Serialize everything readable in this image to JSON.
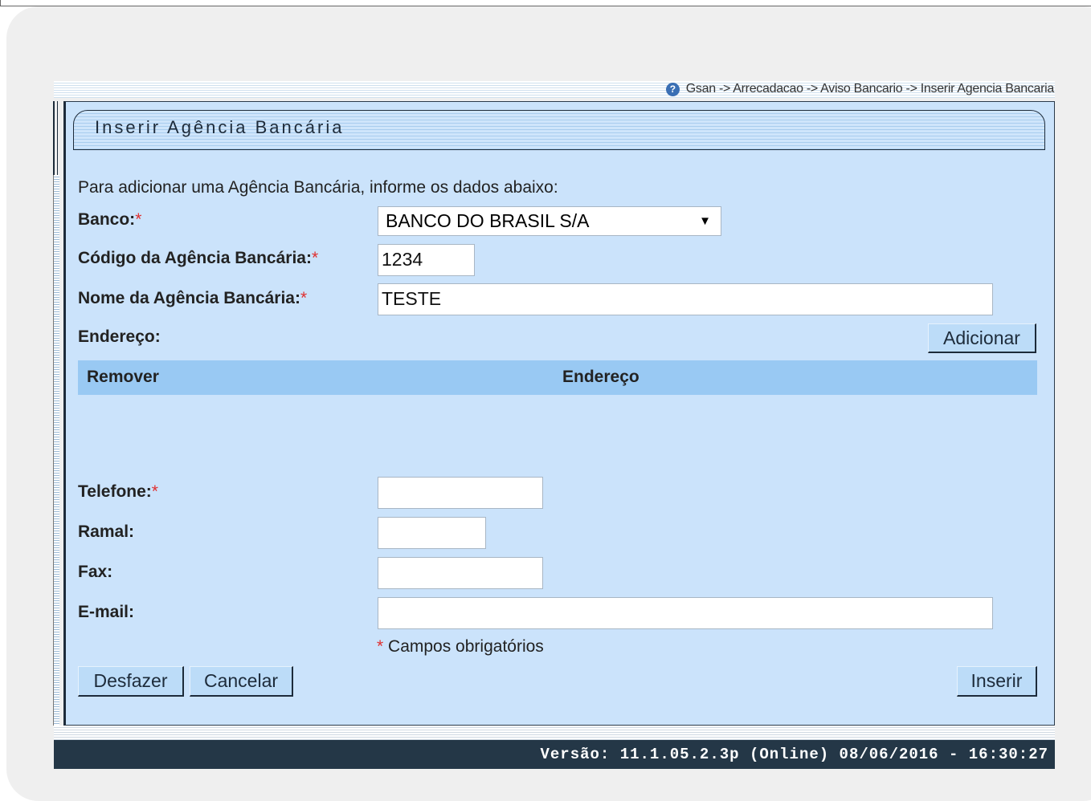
{
  "breadcrumb": "Gsan -> Arrecadacao -> Aviso Bancario -> Inserir Agencia Bancaria",
  "title": "Inserir Agência Bancária",
  "intro": "Para adicionar uma Agência Bancária, informe os dados abaixo:",
  "form": {
    "banco_label": "Banco:",
    "banco_value": "BANCO DO BRASIL S/A",
    "codigo_label": "Código da Agência Bancária:",
    "codigo_value": "1234",
    "nome_label": "Nome da Agência Bancária:",
    "nome_value": "TESTE",
    "endereco_label": "Endereço:",
    "telefone_label": "Telefone:",
    "telefone_value": "",
    "ramal_label": "Ramal:",
    "ramal_value": "",
    "fax_label": "Fax:",
    "fax_value": "",
    "email_label": "E-mail:",
    "email_value": "",
    "required_mark": "*",
    "required_note": "Campos obrigatórios"
  },
  "table": {
    "columns": [
      "Remover",
      "Endereço"
    ]
  },
  "buttons": {
    "adicionar": "Adicionar",
    "desfazer": "Desfazer",
    "cancelar": "Cancelar",
    "inserir": "Inserir"
  },
  "footer": "Versão: 11.1.05.2.3p (Online) 08/06/2016 - 16:30:27",
  "colors": {
    "panel_bg": "#cbe3fb",
    "table_head": "#99c9f3",
    "footer_bg": "#243747",
    "required": "#e03030"
  }
}
